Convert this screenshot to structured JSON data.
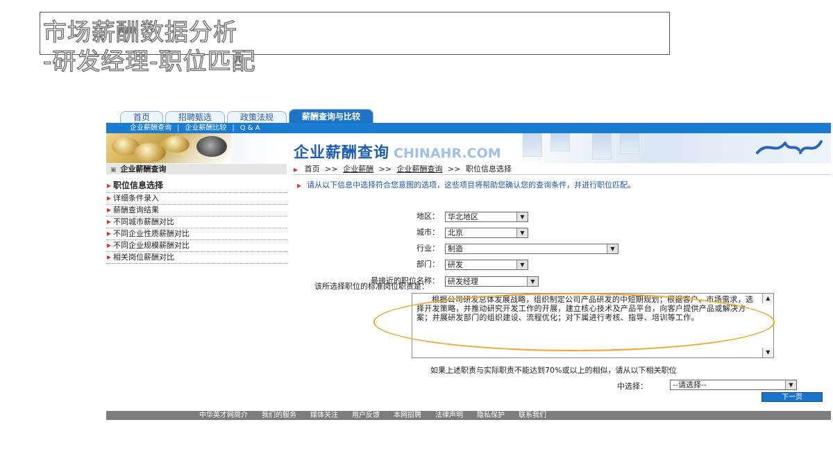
{
  "slide": {
    "title_line1": "市场薪酬数据分析",
    "title_line2": "-研发经理-职位匹配"
  },
  "tabs": [
    "首页",
    "招聘甄选",
    "政策法规",
    "薪酬查询与比较"
  ],
  "subnav": [
    "企业薪酬查询",
    "|",
    "企业薪酬比较",
    "|",
    "Q & A"
  ],
  "banner": {
    "title": "企业薪酬查询",
    "site": "CHINAHR.COM"
  },
  "sidebar": {
    "header": "企业薪酬查询",
    "items": [
      "职位信息选择",
      "详细条件录入",
      "薪酬查询结果",
      "不同城市薪酬对比",
      "不同企业性质薪酬对比",
      "不同企业规模薪酬对比",
      "相关岗位薪酬对比"
    ]
  },
  "breadcrumb": {
    "home": "首页",
    "sep": ">>",
    "c1": "企业薪酬",
    "c2": "企业薪酬查询",
    "c3": "职位信息选择"
  },
  "instruction": "请从以下信息中选择符合您意图的选项，这些项目将帮助您确认您的查询条件，并进行职位匹配。",
  "form": {
    "region_label": "地区：",
    "region_value": "华北地区",
    "city_label": "城市：",
    "city_value": "北京",
    "industry_label": "行业：",
    "industry_value": "制造",
    "dept_label": "部门：",
    "dept_value": "研发",
    "position_label": "最接近的职位名称：",
    "position_value": "研发经理"
  },
  "responsibility": {
    "label": "该所选择职位的标准岗位职责是：",
    "text": "根据公司研发总体发展战略，组织制定公司产品研发的中短期规划；根据客户、市场需求，选择开发策略，并推动研究开发工作的开展，建立核心技术及产品平台，向客户提供产品或解决方案；并展研发部门的组织建设、流程优化；对下属进行考核、指导、培训等工作。"
  },
  "note": "如果上述职责与实际职责不能达到70%或以上的相似，请从以下相关职位",
  "pick": {
    "label": "中选择：",
    "value": "--请选择--"
  },
  "next_button": "下一页",
  "footer": [
    "中华英才网简介",
    "我们的服务",
    "媒体关注",
    "用户反馈",
    "本网招聘",
    "法律声明",
    "隐私保护",
    "联系我们"
  ],
  "colors": {
    "brand_blue": "#1a7cd0",
    "highlight_orange": "#f4a326",
    "footer_gray": "#7c7c7c"
  }
}
